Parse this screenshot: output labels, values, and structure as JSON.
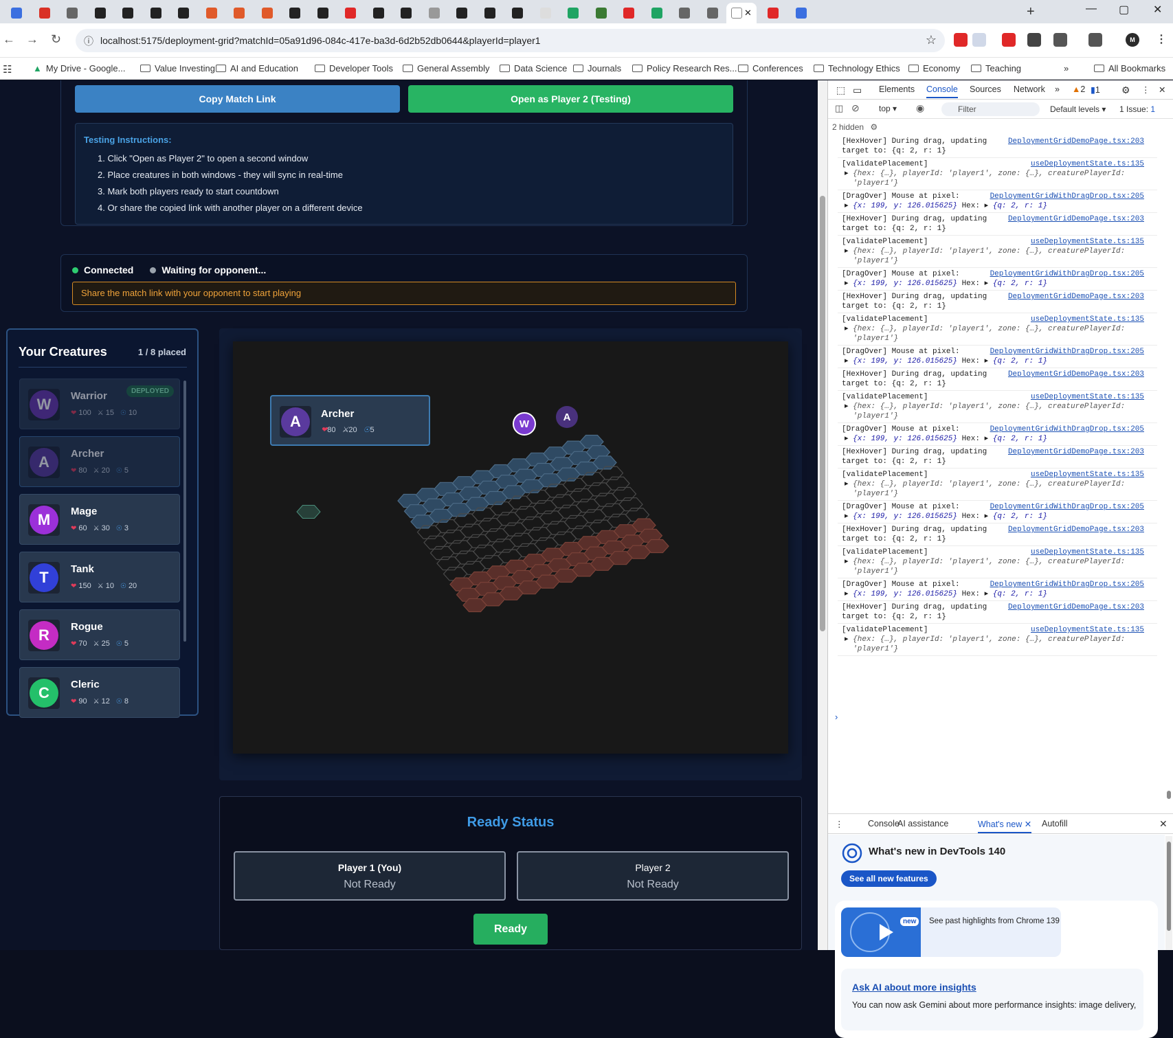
{
  "browser": {
    "url": "localhost:5175/deployment-grid?matchId=05a91d96-084c-417e-ba3d-6d2b52db0644&playerId=player1",
    "bookmarks": [
      "My Drive - Google...",
      "Value Investing",
      "AI and Education",
      "Developer Tools",
      "General Assembly",
      "Data Science",
      "Journals",
      "Policy Research Res...",
      "Conferences",
      "Technology Ethics",
      "Economy",
      "Teaching"
    ],
    "all_bookmarks": "All Bookmarks"
  },
  "actions": {
    "copy_link": "Copy Match Link",
    "open_player2": "Open as Player 2 (Testing)"
  },
  "instructions": {
    "title": "Testing Instructions:",
    "steps": [
      "1. Click \"Open as Player 2\" to open a second window",
      "2. Place creatures in both windows - they will sync in real-time",
      "3. Mark both players ready to start countdown",
      "4. Or share the copied link with another player on a different device"
    ]
  },
  "connection": {
    "status": "Connected",
    "opponent": "Waiting for opponent...",
    "alert": "Share the match link with your opponent to start playing",
    "connected_color": "#2ecc71",
    "waiting_color": "#9aa3ad"
  },
  "creatures_panel": {
    "title": "Your Creatures",
    "placed": "1 / 8 placed",
    "deployed_badge": "DEPLOYED",
    "creatures": [
      {
        "letter": "W",
        "name": "Warrior",
        "hp": "100",
        "atk": "15",
        "def": "10",
        "color": "#6b35b0",
        "deployed": true
      },
      {
        "letter": "A",
        "name": "Archer",
        "hp": "80",
        "atk": "20",
        "def": "5",
        "color": "#5a3a9e",
        "dragging": true
      },
      {
        "letter": "M",
        "name": "Mage",
        "hp": "60",
        "atk": "30",
        "def": "3",
        "color": "#9b30d9"
      },
      {
        "letter": "T",
        "name": "Tank",
        "hp": "150",
        "atk": "10",
        "def": "20",
        "color": "#3140d8"
      },
      {
        "letter": "R",
        "name": "Rogue",
        "hp": "70",
        "atk": "25",
        "def": "5",
        "color": "#c42cc4"
      },
      {
        "letter": "C",
        "name": "Cleric",
        "hp": "90",
        "atk": "12",
        "def": "8",
        "color": "#24c06a"
      }
    ]
  },
  "drag_preview": {
    "letter": "A",
    "name": "Archer",
    "hp": "80",
    "atk": "20",
    "def": "5"
  },
  "board": {
    "placed_tokens": [
      {
        "letter": "W",
        "color": "#7a3ad0"
      },
      {
        "letter": "A",
        "color": "#5a3a9e"
      }
    ],
    "player_zone_color": "#2f4a63",
    "enemy_zone_color": "#5a2f2a",
    "neutral_stroke": "#4a4a4a"
  },
  "ready": {
    "title": "Ready Status",
    "player1": {
      "name": "Player 1 (You)",
      "status": "Not Ready"
    },
    "player2": {
      "name": "Player 2",
      "status": "Not Ready"
    },
    "button": "Ready"
  },
  "devtools": {
    "tabs": [
      "Elements",
      "Console",
      "Sources",
      "Network"
    ],
    "warnings": "2",
    "errors": "1",
    "context": "top",
    "filter_placeholder": "Filter",
    "levels": "Default levels",
    "issues": "1 Issue:",
    "issues_count": "1",
    "hidden": "2 hidden",
    "logs": [
      {
        "type": "hover",
        "line1": "[HexHover] During drag, updating",
        "line2": "target to: {q: 2, r: 1}",
        "src": "DeploymentGridDemoPage.tsx:203"
      },
      {
        "type": "validate",
        "line1": "[validatePlacement]",
        "src": "useDeploymentState.ts:135"
      },
      {
        "type": "drag",
        "line1": "[DragOver] Mouse at pixel:",
        "src": "DeploymentGridWithDragDrop.tsx:205"
      },
      {
        "type": "hover",
        "line1": "[HexHover] During drag, updating",
        "line2": "target to: {q: 2, r: 1}",
        "src": "DeploymentGridDemoPage.tsx:203"
      },
      {
        "type": "validate",
        "line1": "[validatePlacement]",
        "src": "useDeploymentState.ts:135"
      },
      {
        "type": "drag",
        "line1": "[DragOver] Mouse at pixel:",
        "src": "DeploymentGridWithDragDrop.tsx:205"
      },
      {
        "type": "hover",
        "line1": "[HexHover] During drag, updating",
        "line2": "target to: {q: 2, r: 1}",
        "src": "DeploymentGridDemoPage.tsx:203"
      },
      {
        "type": "validate",
        "line1": "[validatePlacement]",
        "src": "useDeploymentState.ts:135"
      },
      {
        "type": "drag",
        "line1": "[DragOver] Mouse at pixel:",
        "src": "DeploymentGridWithDragDrop.tsx:205"
      },
      {
        "type": "hover",
        "line1": "[HexHover] During drag, updating",
        "line2": "target to: {q: 2, r: 1}",
        "src": "DeploymentGridDemoPage.tsx:203"
      },
      {
        "type": "validate",
        "line1": "[validatePlacement]",
        "src": "useDeploymentState.ts:135"
      },
      {
        "type": "drag",
        "line1": "[DragOver] Mouse at pixel:",
        "src": "DeploymentGridWithDragDrop.tsx:205"
      },
      {
        "type": "hover",
        "line1": "[HexHover] During drag, updating",
        "line2": "target to: {q: 2, r: 1}",
        "src": "DeploymentGridDemoPage.tsx:203"
      },
      {
        "type": "validate",
        "line1": "[validatePlacement]",
        "src": "useDeploymentState.ts:135"
      },
      {
        "type": "drag",
        "line1": "[DragOver] Mouse at pixel:",
        "src": "DeploymentGridWithDragDrop.tsx:205"
      },
      {
        "type": "hover",
        "line1": "[HexHover] During drag, updating",
        "line2": "target to: {q: 2, r: 1}",
        "src": "DeploymentGridDemoPage.tsx:203"
      },
      {
        "type": "validate",
        "line1": "[validatePlacement]",
        "src": "useDeploymentState.ts:135"
      },
      {
        "type": "drag",
        "line1": "[DragOver] Mouse at pixel:",
        "src": "DeploymentGridWithDragDrop.tsx:205"
      },
      {
        "type": "hover",
        "line1": "[HexHover] During drag, updating",
        "line2": "target to: {q: 2, r: 1}",
        "src": "DeploymentGridDemoPage.tsx:203"
      },
      {
        "type": "validate",
        "line1": "[validatePlacement]",
        "src": "useDeploymentState.ts:135"
      }
    ],
    "validate_obj": "{hex: {…}, playerId: 'player1', zone: {…}, creaturePlayerId: 'player1'}",
    "drag_obj": "{x: 199, y: 126.015625}",
    "hex_obj": "{q: 2, r: 1}",
    "drawer_tabs": [
      "Console",
      "AI assistance",
      "What's new",
      "Autofill"
    ],
    "whats_new_title": "What's new in DevTools 140",
    "see_all": "See all new features",
    "highlights_badge": "new",
    "highlights": "See past highlights from Chrome 139",
    "ask_ai": "Ask AI about more insights",
    "ask_ai_text": "You can now ask Gemini about more performance insights: image delivery,"
  }
}
